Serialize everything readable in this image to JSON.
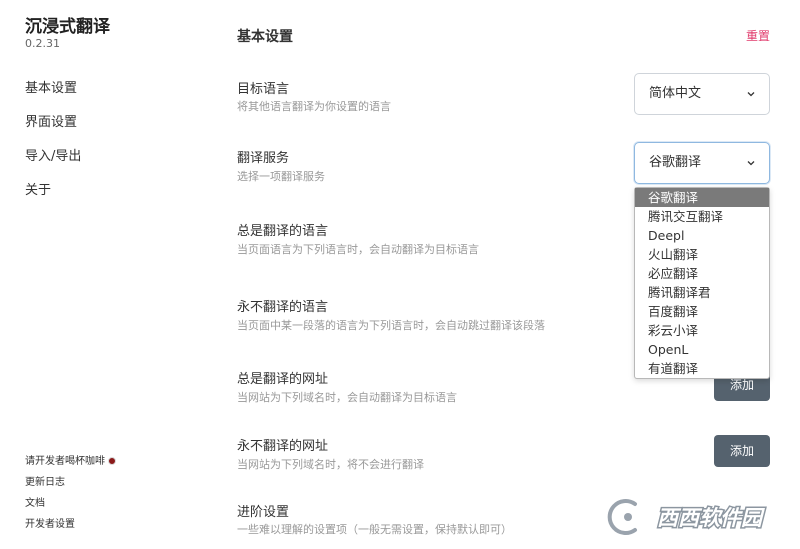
{
  "app": {
    "title": "沉浸式翻译",
    "version": "0.2.31"
  },
  "sidebar": {
    "items": [
      {
        "label": "基本设置"
      },
      {
        "label": "界面设置"
      },
      {
        "label": "导入/导出"
      },
      {
        "label": "关于"
      }
    ],
    "footer": {
      "coffee": "请开发者喝杯咖啡",
      "changelog": "更新日志",
      "docs": "文档",
      "developer": "开发者设置"
    }
  },
  "main": {
    "title": "基本设置",
    "reset": "重置",
    "target_language": {
      "title": "目标语言",
      "desc": "将其他语言翻译为你设置的语言",
      "value": "简体中文"
    },
    "translation_service": {
      "title": "翻译服务",
      "desc": "选择一项翻译服务",
      "value": "谷歌翻译",
      "options": [
        "谷歌翻译",
        "腾讯交互翻译",
        "Deepl",
        "火山翻译",
        "必应翻译",
        "腾讯翻译君",
        "百度翻译",
        "彩云小译",
        "OpenL",
        "有道翻译"
      ]
    },
    "always_translate_languages": {
      "title": "总是翻译的语言",
      "desc": "当页面语言为下列语言时，会自动翻译为目标语言"
    },
    "never_translate_languages": {
      "title": "永不翻译的语言",
      "desc": "当页面中某一段落的语言为下列语言时，会自动跳过翻译该段落"
    },
    "always_translate_urls": {
      "title": "总是翻译的网址",
      "desc": "当网站为下列域名时，会自动翻译为目标语言",
      "button": "添加"
    },
    "never_translate_urls": {
      "title": "永不翻译的网址",
      "desc": "当网站为下列域名时，将不会进行翻译",
      "button": "添加"
    },
    "advanced": {
      "title": "进阶设置",
      "desc": "一些难以理解的设置项（一般无需设置，保持默认即可）"
    }
  },
  "watermark": {
    "text": "西西软件园"
  },
  "colors": {
    "accent": "#e03a6b",
    "button": "#55626e",
    "selected_option": "#7a7a7a"
  }
}
